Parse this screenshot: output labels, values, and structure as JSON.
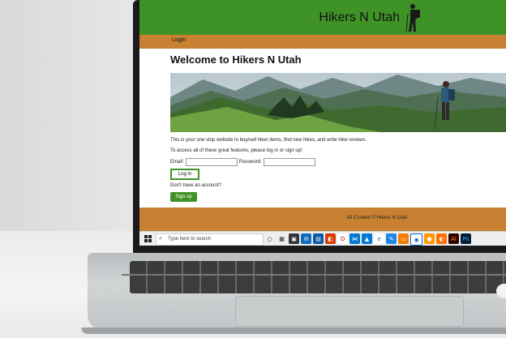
{
  "site": {
    "title": "Hikers N Utah",
    "nav_login": "Login",
    "welcome_heading": "Welcome to Hikers N Utah",
    "intro_text": "This is your one stop website to buy/sell hiker items, find new hikes, and write hike reviews.",
    "access_text": "To access all of these great features, please log in or sign up!",
    "email_label": "Email:",
    "password_label": "Password:",
    "login_button": "Log in",
    "no_account_text": "Don't have an account?",
    "signup_button": "Sign up",
    "footer_text": "All Content © Hikers N Utah"
  },
  "taskbar": {
    "search_placeholder": "Type here to search",
    "icons": [
      "start-icon",
      "task-view-icon",
      "widgets-icon",
      "store-icon",
      "mail-icon",
      "calendar-icon",
      "office-icon",
      "opera-icon",
      "vscode-icon",
      "photos-icon",
      "edge-icon",
      "notepad-icon",
      "terminal-icon",
      "chrome-icon",
      "app-icon",
      "illustrator-icon",
      "photoshop-icon"
    ]
  },
  "colors": {
    "header_green": "#3f9326",
    "nav_brown": "#c88132",
    "button_green": "#3f9326"
  }
}
